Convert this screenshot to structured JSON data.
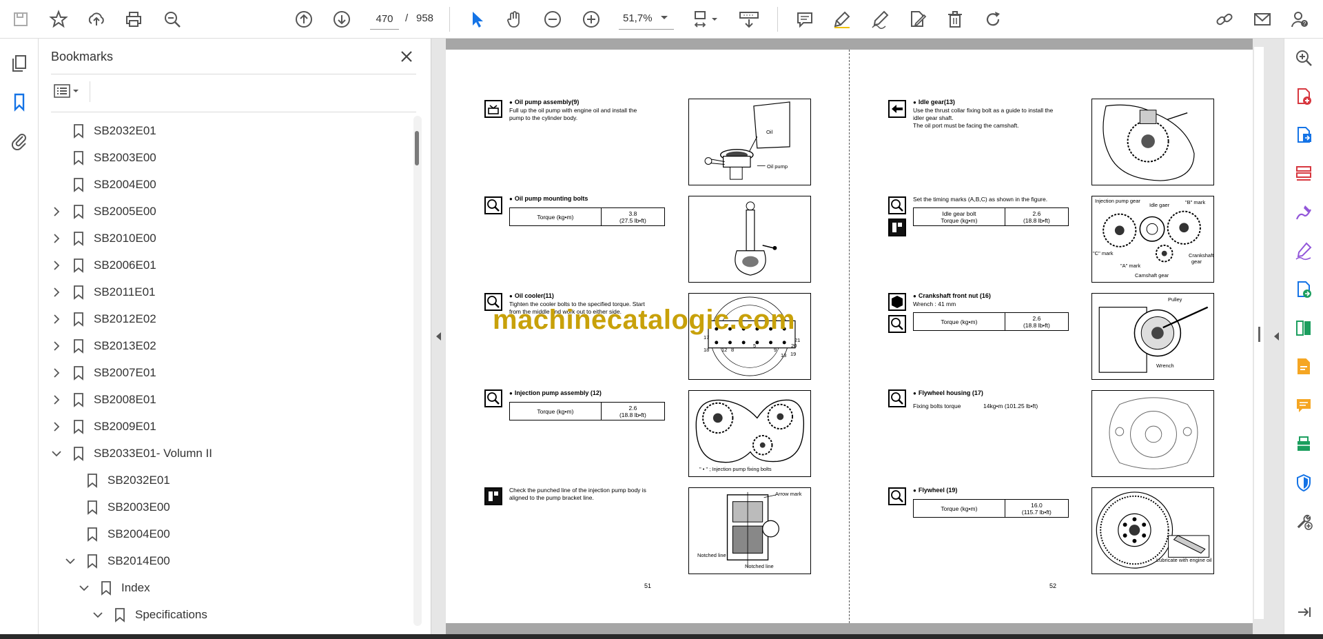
{
  "toolbar": {
    "page_current": "470",
    "page_separator": "/",
    "page_total": "958",
    "zoom": "51,7%",
    "icons": [
      "save-icon",
      "star-icon",
      "upload-icon",
      "print-icon",
      "zoom-search-icon",
      "arrow-up-circle-icon",
      "arrow-down-circle-icon",
      "minus-circle-icon",
      "plus-circle-icon",
      "cursor-icon",
      "hand-icon",
      "page-fit-icon",
      "scroll-mode-icon",
      "comment-icon",
      "highlighter-icon",
      "pen-sign-icon",
      "edit-document-icon",
      "trash-icon",
      "redo-icon",
      "link-icon",
      "mail-icon",
      "account-icon"
    ]
  },
  "left_rail": {
    "icons": [
      "pages-icon",
      "bookmark-icon",
      "attachment-icon"
    ]
  },
  "bookmarks": {
    "title": "Bookmarks",
    "items": [
      {
        "label": "SB2032E01",
        "level": 0,
        "expand": "none"
      },
      {
        "label": "SB2003E00",
        "level": 0,
        "expand": "none"
      },
      {
        "label": "SB2004E00",
        "level": 0,
        "expand": "none"
      },
      {
        "label": "SB2005E00",
        "level": 0,
        "expand": "collapsed"
      },
      {
        "label": "SB2010E00",
        "level": 0,
        "expand": "collapsed"
      },
      {
        "label": "SB2006E01",
        "level": 0,
        "expand": "collapsed"
      },
      {
        "label": "SB2011E01",
        "level": 0,
        "expand": "collapsed"
      },
      {
        "label": "SB2012E02",
        "level": 0,
        "expand": "collapsed"
      },
      {
        "label": "SB2013E02",
        "level": 0,
        "expand": "collapsed"
      },
      {
        "label": "SB2007E01",
        "level": 0,
        "expand": "collapsed"
      },
      {
        "label": "SB2008E01",
        "level": 0,
        "expand": "collapsed"
      },
      {
        "label": "SB2009E01",
        "level": 0,
        "expand": "collapsed"
      },
      {
        "label": "SB2033E01- Volumn II",
        "level": 0,
        "expand": "expanded"
      },
      {
        "label": "SB2032E01",
        "level": 1,
        "expand": "none"
      },
      {
        "label": "SB2003E00",
        "level": 1,
        "expand": "none"
      },
      {
        "label": "SB2004E00",
        "level": 1,
        "expand": "none"
      },
      {
        "label": "SB2014E00",
        "level": 1,
        "expand": "expanded"
      },
      {
        "label": "Index",
        "level": 2,
        "expand": "expanded"
      },
      {
        "label": "Specifications",
        "level": 3,
        "expand": "expanded"
      }
    ]
  },
  "document": {
    "watermark": "machinecatalogic.com",
    "left_page": {
      "page_number": "51",
      "steps": [
        {
          "title": "Oil pump assembly(9)",
          "text": [
            "Full up the oil pump with engine oil and install the",
            "pump to the cylinder body."
          ],
          "figure_labels": [
            "Oil",
            "Oil pump"
          ]
        },
        {
          "title": "Oil pump mounting bolts",
          "torque_label": "Torque  (kg•m)",
          "torque_value": "3.8",
          "torque_imperial": "(27.5 lb•ft)"
        },
        {
          "title": "Oil cooler(11)",
          "text": [
            "Tighten the cooler bolts to the specified torque. Start",
            "from the middle and work out to either side."
          ],
          "figure_labels": [
            "17",
            "18",
            "12",
            "8",
            "5",
            "9",
            "20",
            "21",
            "19",
            "13"
          ]
        },
        {
          "title": "Injection pump assembly (12)",
          "torque_label": "Torque  (kg•m)",
          "torque_value": "2.6",
          "torque_imperial": "(18.8 lb•ft)",
          "figure_labels": [
            "\" • \" ; Injection pump fixing bolts"
          ]
        },
        {
          "text": [
            "Check the punched line of the injection pump body is",
            "aligned to the pump bracket line."
          ],
          "figure_labels": [
            "Arrow mark",
            "Notched line",
            "Notched line"
          ]
        }
      ]
    },
    "right_page": {
      "page_number": "52",
      "steps": [
        {
          "title": "Idle gear(13)",
          "text": [
            "Use the thrust collar fixing bolt as a guide to install the",
            "idler gear shaft.",
            "The oil port must be facing the camshaft."
          ]
        },
        {
          "text": [
            "Set the timing marks (A,B,C) as shown in the figure."
          ],
          "torque_label_1": "Idle gear bolt",
          "torque_label_2": "Torque  (kg•m)",
          "torque_value": "2.6",
          "torque_imperial": "(18.8 lb•ft)",
          "figure_labels": [
            "Injection pump gear",
            "Idle gaer",
            "\"B\" mark",
            "\"C\" mark",
            "\"A\" mark",
            "Crankshaft",
            "gear",
            "Camshaft gear"
          ]
        },
        {
          "title": "Crankshaft front nut (16)",
          "text": [
            "Wrench : 41 mm"
          ],
          "torque_label": "Torque  (kg•m)",
          "torque_value": "2.6",
          "torque_imperial": "(18.8 lb•ft)",
          "figure_labels": [
            "Pulley",
            "Wrench"
          ]
        },
        {
          "title": "Flywheel housing (17)",
          "text": [
            "Fixing bolts torque"
          ],
          "torque_inline": "14kg•m  (101.25 lb•ft)"
        },
        {
          "title": "Flywheel (19)",
          "torque_label": "Torque  (kg•m)",
          "torque_value": "16.0",
          "torque_imperial": "(115.7 lb•ft)",
          "figure_labels": [
            "Lubricate with engine oil"
          ]
        }
      ]
    }
  },
  "right_rail": {
    "icons": [
      "zoom-in-icon",
      "create-pdf-icon",
      "export-pdf-icon",
      "organize-pages-icon",
      "fill-sign-icon",
      "sign-icon",
      "combine-files-icon",
      "compare-icon",
      "edit-pdf-icon",
      "comment-tool-icon",
      "scan-ocr-icon",
      "protect-icon",
      "more-tools-icon",
      "expand-panel-icon"
    ]
  },
  "colors": {
    "accent": "#1473e6",
    "watermark": "#c8a10a",
    "tool_pink": "#d7373f",
    "tool_purple": "#9256d9"
  }
}
